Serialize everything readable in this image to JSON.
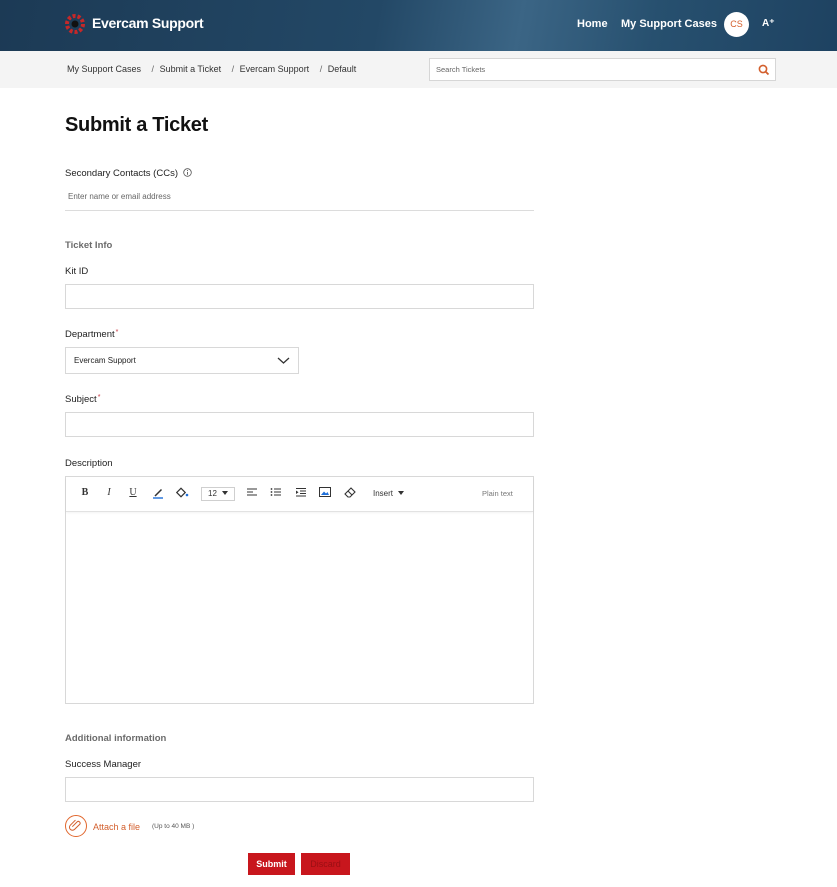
{
  "header": {
    "brand": "Evercam Support",
    "nav_home": "Home",
    "nav_cases": "My Support Cases",
    "avatar_initials": "CS",
    "font_size_toggle": "A⁺"
  },
  "breadcrumb": {
    "items": [
      "My Support Cases",
      "Submit a Ticket",
      "Evercam Support",
      "Default"
    ],
    "separator": "/"
  },
  "search": {
    "placeholder": "Search Tickets"
  },
  "page": {
    "title": "Submit a Ticket"
  },
  "form": {
    "cc_label": "Secondary Contacts (CCs)",
    "cc_placeholder": "Enter name or email address",
    "ticket_info": "Ticket Info",
    "kit_id_label": "Kit ID",
    "department_label": "Department",
    "department_value": "Evercam Support",
    "subject_label": "Subject",
    "description_label": "Description",
    "required_marker": "*",
    "additional_info": "Additional information",
    "success_manager_label": "Success Manager",
    "attach_label": "Attach a file",
    "attach_hint": "(Up to 40 MB )",
    "submit": "Submit",
    "discard": "Discard"
  },
  "editor_toolbar": {
    "bold": "B",
    "italic": "I",
    "underline": "U",
    "font_size": "12",
    "insert": "Insert",
    "plain_text": "Plain text"
  },
  "colors": {
    "header_bg": "#234866",
    "accent": "#d35f2d",
    "button": "#c8161d"
  }
}
